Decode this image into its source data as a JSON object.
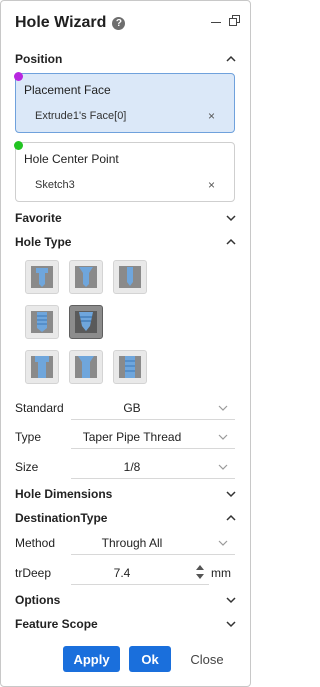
{
  "window": {
    "title": "Hole Wizard",
    "help_glyph": "?"
  },
  "sections": {
    "position": "Position",
    "favorite": "Favorite",
    "hole_type": "Hole Type",
    "hole_dimensions": "Hole Dimensions",
    "destination_type": "DestinationType",
    "options": "Options",
    "feature_scope": "Feature Scope"
  },
  "placement_face": {
    "label": "Placement Face",
    "value": "Extrude1's Face[0]",
    "clear": "×",
    "marker_color": "#b827e0",
    "bg": "#dbe8f8",
    "border": "#6fa1dc"
  },
  "hole_center": {
    "label": "Hole Center Point",
    "value": "Sketch3",
    "clear": "×",
    "marker_color": "#22c422"
  },
  "hole_types": [
    {
      "icon": "counterbore-hole-icon",
      "selected": false
    },
    {
      "icon": "countersink-hole-icon",
      "selected": false
    },
    {
      "icon": "simple-hole-icon",
      "selected": false
    },
    {
      "icon": "threaded-hole-icon",
      "selected": false
    },
    {
      "icon": "taper-pipe-thread-hole-icon",
      "selected": true
    },
    {
      "icon": "counterbore-through-hole-icon",
      "selected": false
    },
    {
      "icon": "countersink-through-hole-icon",
      "selected": false
    },
    {
      "icon": "tapped-hole-icon",
      "selected": false
    }
  ],
  "fields": {
    "standard": {
      "label": "Standard",
      "value": "GB"
    },
    "type": {
      "label": "Type",
      "value": "Taper Pipe Thread"
    },
    "size": {
      "label": "Size",
      "value": "1/8"
    },
    "method": {
      "label": "Method",
      "value": "Through All"
    },
    "tr_deep": {
      "label": "trDeep",
      "value": "7.4",
      "unit": "mm"
    }
  },
  "buttons": {
    "apply": "Apply",
    "ok": "Ok",
    "close": "Close"
  },
  "colors": {
    "accent": "#1a6fdc"
  }
}
